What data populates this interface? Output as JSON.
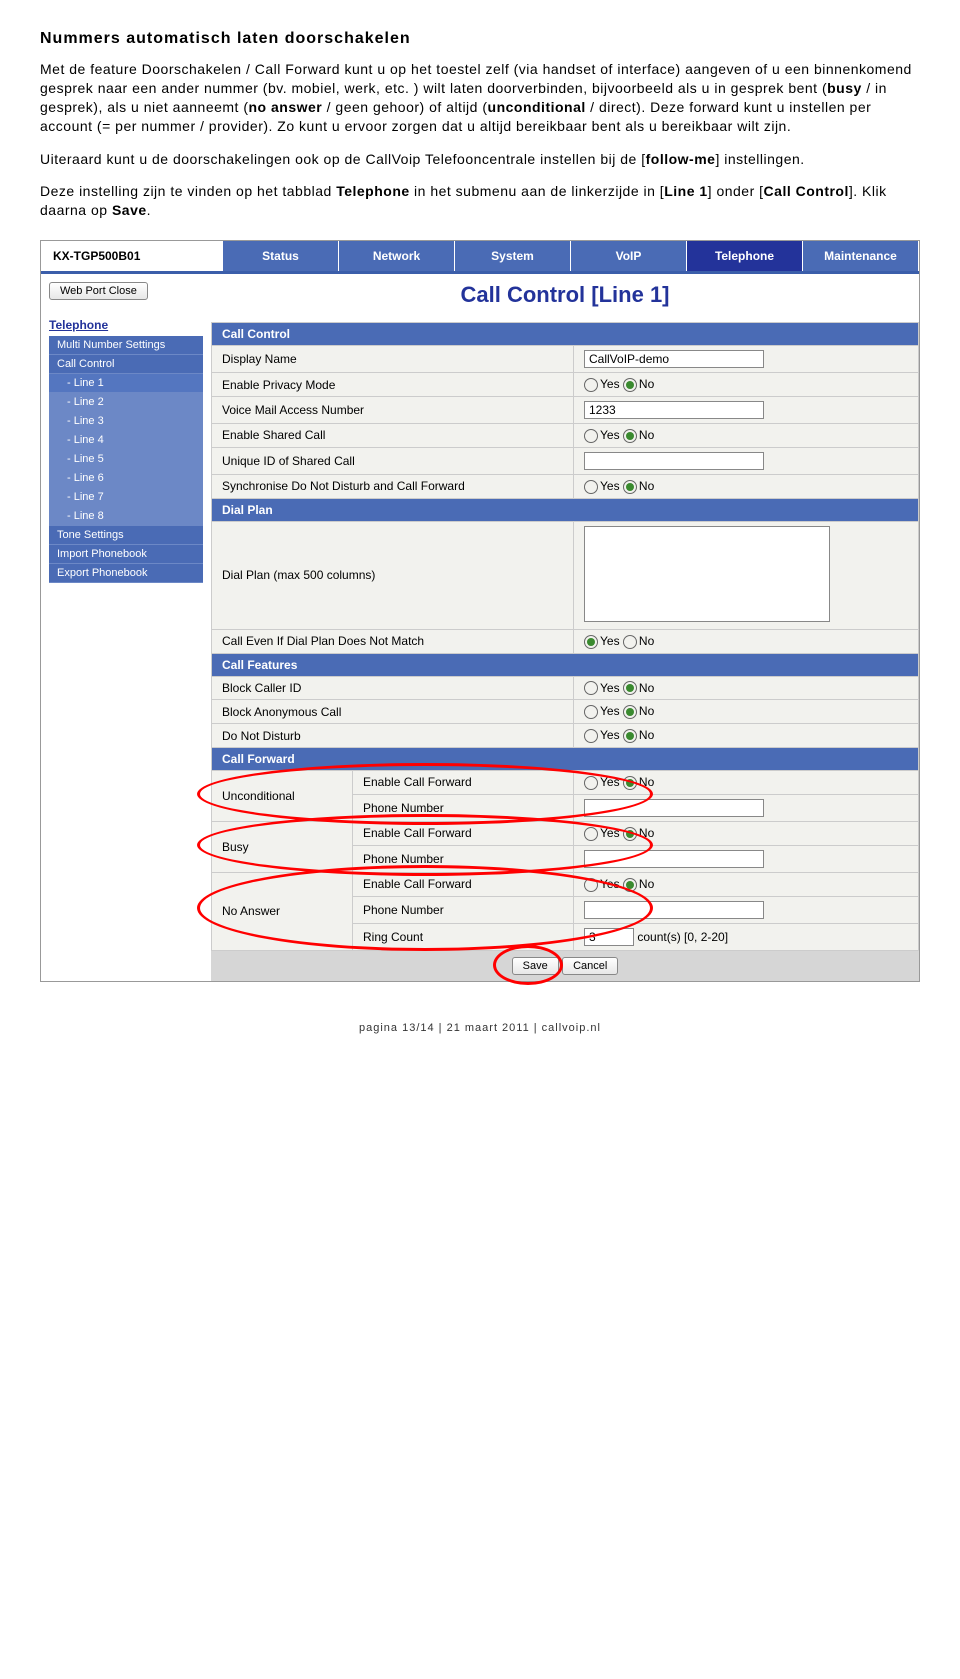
{
  "doc": {
    "heading": "Nummers automatisch laten doorschakelen",
    "p1a": "Met de feature Doorschakelen / Call Forward kunt u op het toestel zelf (via handset of interface) aangeven of u een binnenkomend gesprek naar een ander nummer (bv. mobiel, werk, etc. ) wilt laten doorverbinden, bijvoorbeeld als u in gesprek bent (",
    "p1b": "busy",
    "p1c": " / in gesprek), als u niet aanneemt (",
    "p1d": "no answer",
    "p1e": " / geen gehoor) of altijd (",
    "p1f": "unconditional",
    "p1g": " / direct). Deze forward kunt u instellen per account (= per nummer / provider). Zo kunt u ervoor zorgen dat u altijd bereikbaar bent als u bereikbaar wilt zijn.",
    "p2a": "Uiteraard kunt u de doorschakelingen ook op de CallVoip Telefooncentrale instellen bij de [",
    "p2b": "follow-me",
    "p2c": "] instellingen.",
    "p3a": "Deze instelling zijn te vinden op het tabblad ",
    "p3b": "Telephone",
    "p3c": " in het submenu aan de linkerzijde in [",
    "p3d": "Line 1",
    "p3e": "] onder [",
    "p3f": "Call Control",
    "p3g": "]. Klik daarna op ",
    "p3h": "Save",
    "p3i": "."
  },
  "header": {
    "device": "KX-TGP500B01",
    "tabs": [
      "Status",
      "Network",
      "System",
      "VoIP",
      "Telephone",
      "Maintenance"
    ]
  },
  "side": {
    "button": "Web Port Close",
    "title": "Telephone",
    "items": [
      "Multi Number Settings",
      "Call Control"
    ],
    "lines": [
      "- Line 1",
      "- Line 2",
      "- Line 3",
      "- Line 4",
      "- Line 5",
      "- Line 6",
      "- Line 7",
      "- Line 8"
    ],
    "tail": [
      "Tone Settings",
      "Import Phonebook",
      "Export Phonebook"
    ]
  },
  "page": {
    "title": "Call Control [Line 1]",
    "sections": {
      "callControl": "Call Control",
      "dialPlan": "Dial Plan",
      "callFeatures": "Call Features",
      "callForward": "Call Forward"
    },
    "labels": {
      "displayName": "Display Name",
      "privacy": "Enable Privacy Mode",
      "vmAccess": "Voice Mail Access Number",
      "sharedCall": "Enable Shared Call",
      "uniqueId": "Unique ID of Shared Call",
      "syncDnd": "Synchronise Do Not Disturb and Call Forward",
      "dialPlan": "Dial Plan (max 500 columns)",
      "callEven": "Call Even If Dial Plan Does Not Match",
      "blockCid": "Block Caller ID",
      "blockAnon": "Block Anonymous Call",
      "dnd": "Do Not Disturb",
      "unconditional": "Unconditional",
      "busy": "Busy",
      "noAnswer": "No Answer",
      "enableCF": "Enable Call Forward",
      "phoneNumber": "Phone Number",
      "ringCount": "Ring Count",
      "countHint": "count(s) [0, 2-20]"
    },
    "values": {
      "displayName": "CallVoIP-demo",
      "vmAccess": "1233",
      "ringCount": "3"
    },
    "yes": "Yes",
    "no": "No",
    "save": "Save",
    "cancel": "Cancel"
  },
  "footer": "pagina 13/14  |  21 maart 2011  |  callvoip.nl"
}
